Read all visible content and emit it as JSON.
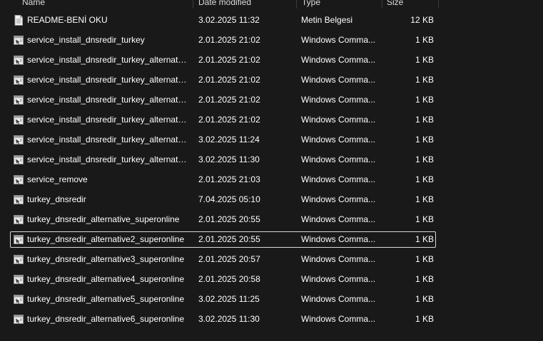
{
  "columns": {
    "name": "Name",
    "date": "Date modified",
    "type": "Type",
    "size": "Size"
  },
  "files": [
    {
      "name": "README-BENİ OKU",
      "date": "3.02.2025 11:32",
      "type": "Metin Belgesi",
      "size": "12 KB",
      "icon": "text-document-icon"
    },
    {
      "name": "service_install_dnsredir_turkey",
      "date": "2.01.2025 21:02",
      "type": "Windows Comma...",
      "size": "1 KB",
      "icon": "batch-file-icon"
    },
    {
      "name": "service_install_dnsredir_turkey_alternativ...",
      "date": "2.01.2025 21:02",
      "type": "Windows Comma...",
      "size": "1 KB",
      "icon": "batch-file-icon"
    },
    {
      "name": "service_install_dnsredir_turkey_alternativ...",
      "date": "2.01.2025 21:02",
      "type": "Windows Comma...",
      "size": "1 KB",
      "icon": "batch-file-icon"
    },
    {
      "name": "service_install_dnsredir_turkey_alternativ...",
      "date": "2.01.2025 21:02",
      "type": "Windows Comma...",
      "size": "1 KB",
      "icon": "batch-file-icon"
    },
    {
      "name": "service_install_dnsredir_turkey_alternativ...",
      "date": "2.01.2025 21:02",
      "type": "Windows Comma...",
      "size": "1 KB",
      "icon": "batch-file-icon"
    },
    {
      "name": "service_install_dnsredir_turkey_alternativ...",
      "date": "3.02.2025 11:24",
      "type": "Windows Comma...",
      "size": "1 KB",
      "icon": "batch-file-icon"
    },
    {
      "name": "service_install_dnsredir_turkey_alternativ...",
      "date": "3.02.2025 11:30",
      "type": "Windows Comma...",
      "size": "1 KB",
      "icon": "batch-file-icon"
    },
    {
      "name": "service_remove",
      "date": "2.01.2025 21:03",
      "type": "Windows Comma...",
      "size": "1 KB",
      "icon": "batch-file-icon"
    },
    {
      "name": "turkey_dnsredir",
      "date": "7.04.2025 05:10",
      "type": "Windows Comma...",
      "size": "1 KB",
      "icon": "batch-file-icon"
    },
    {
      "name": "turkey_dnsredir_alternative_superonline",
      "date": "2.01.2025 20:55",
      "type": "Windows Comma...",
      "size": "1 KB",
      "icon": "batch-file-icon"
    },
    {
      "name": "turkey_dnsredir_alternative2_superonline",
      "date": "2.01.2025 20:55",
      "type": "Windows Comma...",
      "size": "1 KB",
      "icon": "batch-file-icon",
      "selected": true
    },
    {
      "name": "turkey_dnsredir_alternative3_superonline",
      "date": "2.01.2025 20:57",
      "type": "Windows Comma...",
      "size": "1 KB",
      "icon": "batch-file-icon"
    },
    {
      "name": "turkey_dnsredir_alternative4_superonline",
      "date": "2.01.2025 20:58",
      "type": "Windows Comma...",
      "size": "1 KB",
      "icon": "batch-file-icon"
    },
    {
      "name": "turkey_dnsredir_alternative5_superonline",
      "date": "3.02.2025 11:25",
      "type": "Windows Comma...",
      "size": "1 KB",
      "icon": "batch-file-icon"
    },
    {
      "name": "turkey_dnsredir_alternative6_superonline",
      "date": "3.02.2025 11:30",
      "type": "Windows Comma...",
      "size": "1 KB",
      "icon": "batch-file-icon"
    }
  ],
  "colors": {
    "background": "#191919",
    "text": "#ffffff",
    "selection_border": "#d8d8d8"
  }
}
